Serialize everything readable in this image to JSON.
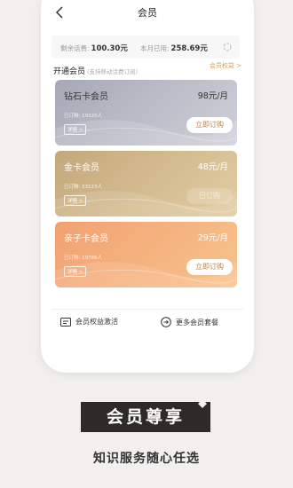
{
  "header": {
    "title": "会员"
  },
  "balance": {
    "remaining_label": "剩余话费:",
    "remaining_value": "100.30元",
    "used_label": "本月已用:",
    "used_value": "258.69元"
  },
  "section": {
    "title": "开通会员",
    "subtitle": "(支持移动话费订阅)",
    "benefits_link": "会员权益 >"
  },
  "cards": [
    {
      "name": "钻石卡会员",
      "price": "98元/月",
      "count": "已订购: 19320人",
      "detail": "详情 >",
      "button": "立即订购"
    },
    {
      "name": "金卡会员",
      "price": "48元/月",
      "count": "已订购: 23123人",
      "detail": "详情 >",
      "button": "已订购"
    },
    {
      "name": "亲子卡会员",
      "price": "29元/月",
      "count": "已订购: 19786人",
      "detail": "详情 >",
      "button": "立即订购"
    }
  ],
  "actions": {
    "activate": "会员权益激活",
    "more": "更多会员套餐"
  },
  "promo": {
    "badge": "会员尊享",
    "tagline": "知识服务随心任选"
  }
}
